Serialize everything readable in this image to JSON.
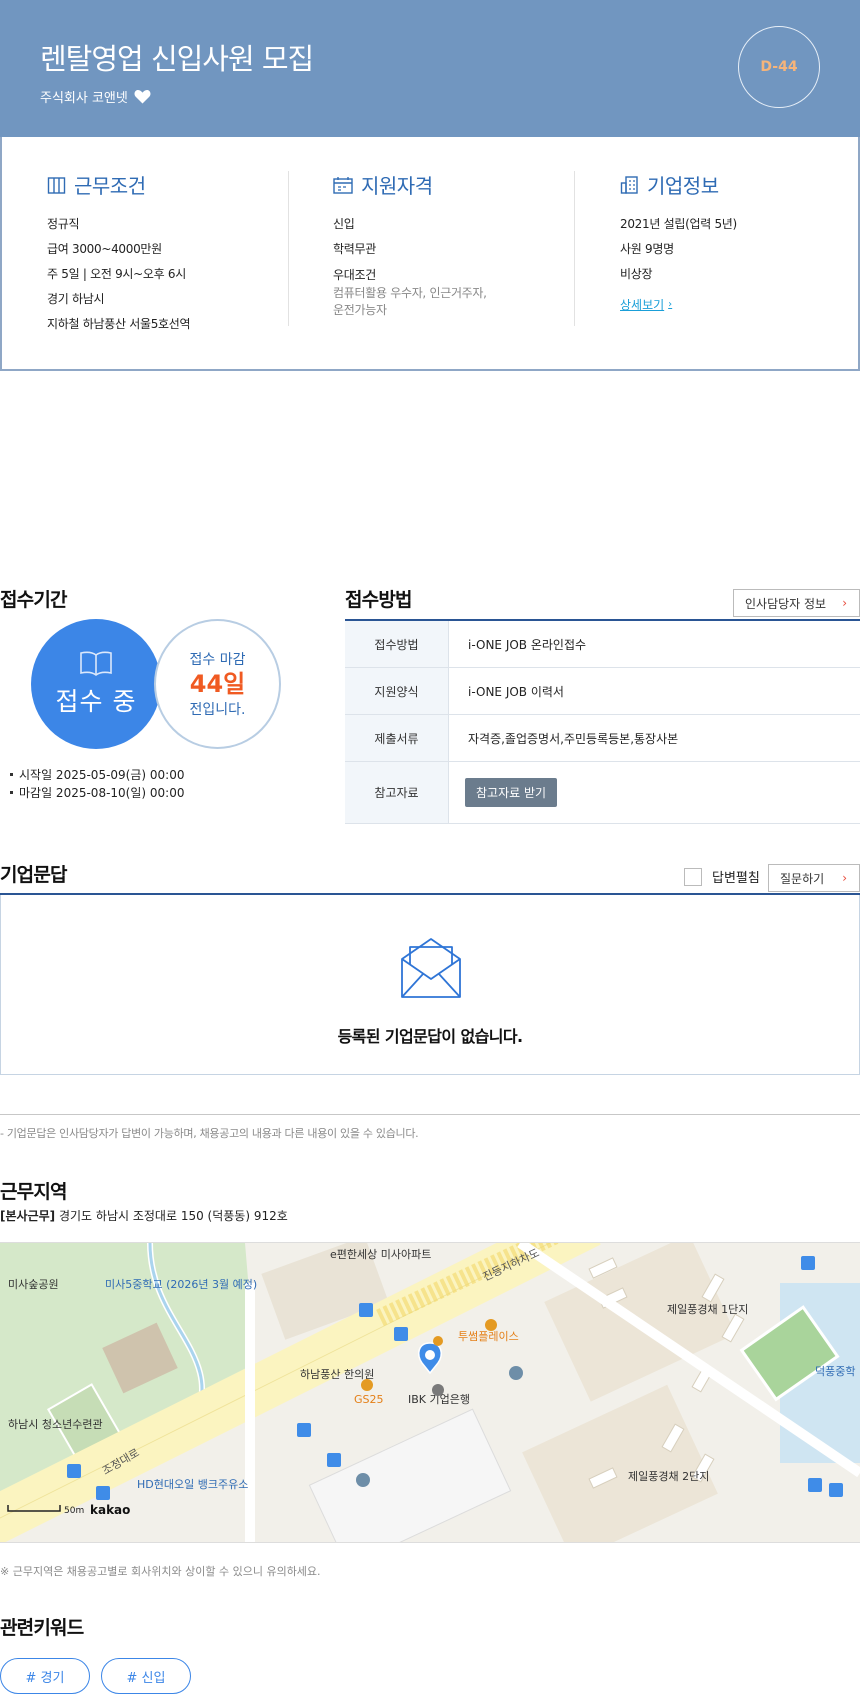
{
  "header": {
    "title": "렌탈영업 신입사원 모집",
    "company": "주식회사 코앤넷",
    "dday": "D-44"
  },
  "conditions": {
    "title": "근무조건",
    "items": [
      "정규직",
      "급여 3000~4000만원",
      "주 5일 | 오전 9시~오후 6시",
      "경기 하남시",
      "지하철 하남풍산 서울5호선역"
    ]
  },
  "qualifications": {
    "title": "지원자격",
    "items": [
      "신입",
      "학력무관",
      "우대조건"
    ],
    "preferred_detail": "컴퓨터활용 우수자, 인근거주자, 운전가능자"
  },
  "company_info": {
    "title": "기업정보",
    "items": [
      "2021년 설립(업력 5년)",
      "사원 9명명",
      "비상장"
    ],
    "more_label": "상세보기"
  },
  "period": {
    "title": "접수기간",
    "status": "접수 중",
    "deadline_label": "접수 마감",
    "days_left": "44일",
    "days_suffix": "전입니다.",
    "start": "시작일 2025-05-09(금) 00:00",
    "end": "마감일 2025-08-10(일) 00:00"
  },
  "method": {
    "title": "접수방법",
    "hr_button": "인사담당자 정보",
    "rows": [
      {
        "key": "접수방법",
        "value": "i-ONE JOB 온라인접수"
      },
      {
        "key": "지원양식",
        "value": "i-ONE JOB 이력서"
      },
      {
        "key": "제출서류",
        "value": "자격증,졸업증명서,주민등록등본,통장사본"
      },
      {
        "key": "참고자료",
        "value": "참고자료 받기"
      }
    ]
  },
  "qa": {
    "title": "기업문답",
    "expand_label": "답변펼침",
    "ask_button": "질문하기",
    "empty_text": "등록된 기업문답이 없습니다.",
    "notice": "- 기업문답은 인사담당자가 답변이 가능하며, 채용공고의 내용과 다른 내용이 있을 수 있습니다."
  },
  "location": {
    "title": "근무지역",
    "tag": "[본사근무]",
    "address": "경기도 하남시 조정대로 150 (덕풍동) 912호",
    "note": "※ 근무지역은 채용공고별로 회사위치와 상이할 수 있으니 유의하세요.",
    "map_labels": {
      "apartment": "e편한세상 미사아파트",
      "park": "미사숲공원",
      "school": "미사5중학교 (2026년 3월 예정)",
      "youth_center": "하남시 청소년수련관",
      "clinic": "하남풍산 한의원",
      "gs25": "GS25",
      "bank": "IBK 기업은행",
      "place": "투썸플레이스",
      "complex1": "제일풍경채 1단지",
      "complex2": "제일풍경채 2단지",
      "middle_school": "덕풍중학",
      "oil": "HD현대오일 뱅크주유소",
      "road1": "진등지하차도",
      "road2": "조정대로",
      "scale": "50m",
      "brand": "kakao"
    }
  },
  "keywords": {
    "title": "관련키워드",
    "items": [
      "# 경기",
      "# 신입"
    ]
  }
}
